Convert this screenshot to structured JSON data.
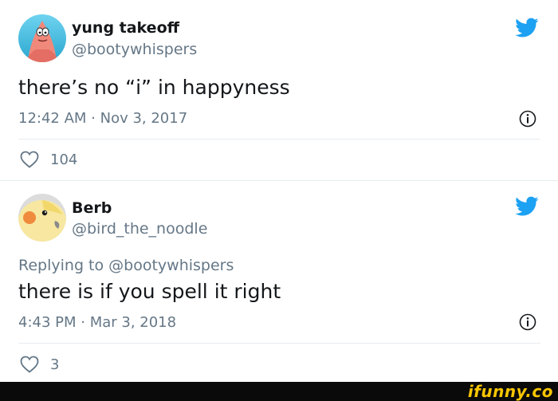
{
  "tweets": [
    {
      "name": "yung takeoff",
      "handle": "@bootywhispers",
      "replying_prefix": "",
      "replying_handle": "",
      "text": "there’s no “i” in happyness",
      "timestamp": "12:42 AM · Nov 3, 2017",
      "likes": "104",
      "icons": {
        "platform": "twitter-bird-icon",
        "info": "info-icon",
        "like": "heart-icon"
      }
    },
    {
      "name": "Berb",
      "handle": "@bird_the_noodle",
      "replying_prefix": "Replying to",
      "replying_handle": "@bootywhispers",
      "text": "there is if you spell it right",
      "timestamp": "4:43 PM · Mar 3, 2018",
      "likes": "3",
      "icons": {
        "platform": "twitter-bird-icon",
        "info": "info-icon",
        "like": "heart-icon"
      }
    }
  ],
  "watermark": {
    "text": "ifunny.co"
  },
  "colors": {
    "brand_blue": "#1da1f2",
    "secondary_text": "#657786",
    "watermark_yellow": "#f7c600"
  }
}
